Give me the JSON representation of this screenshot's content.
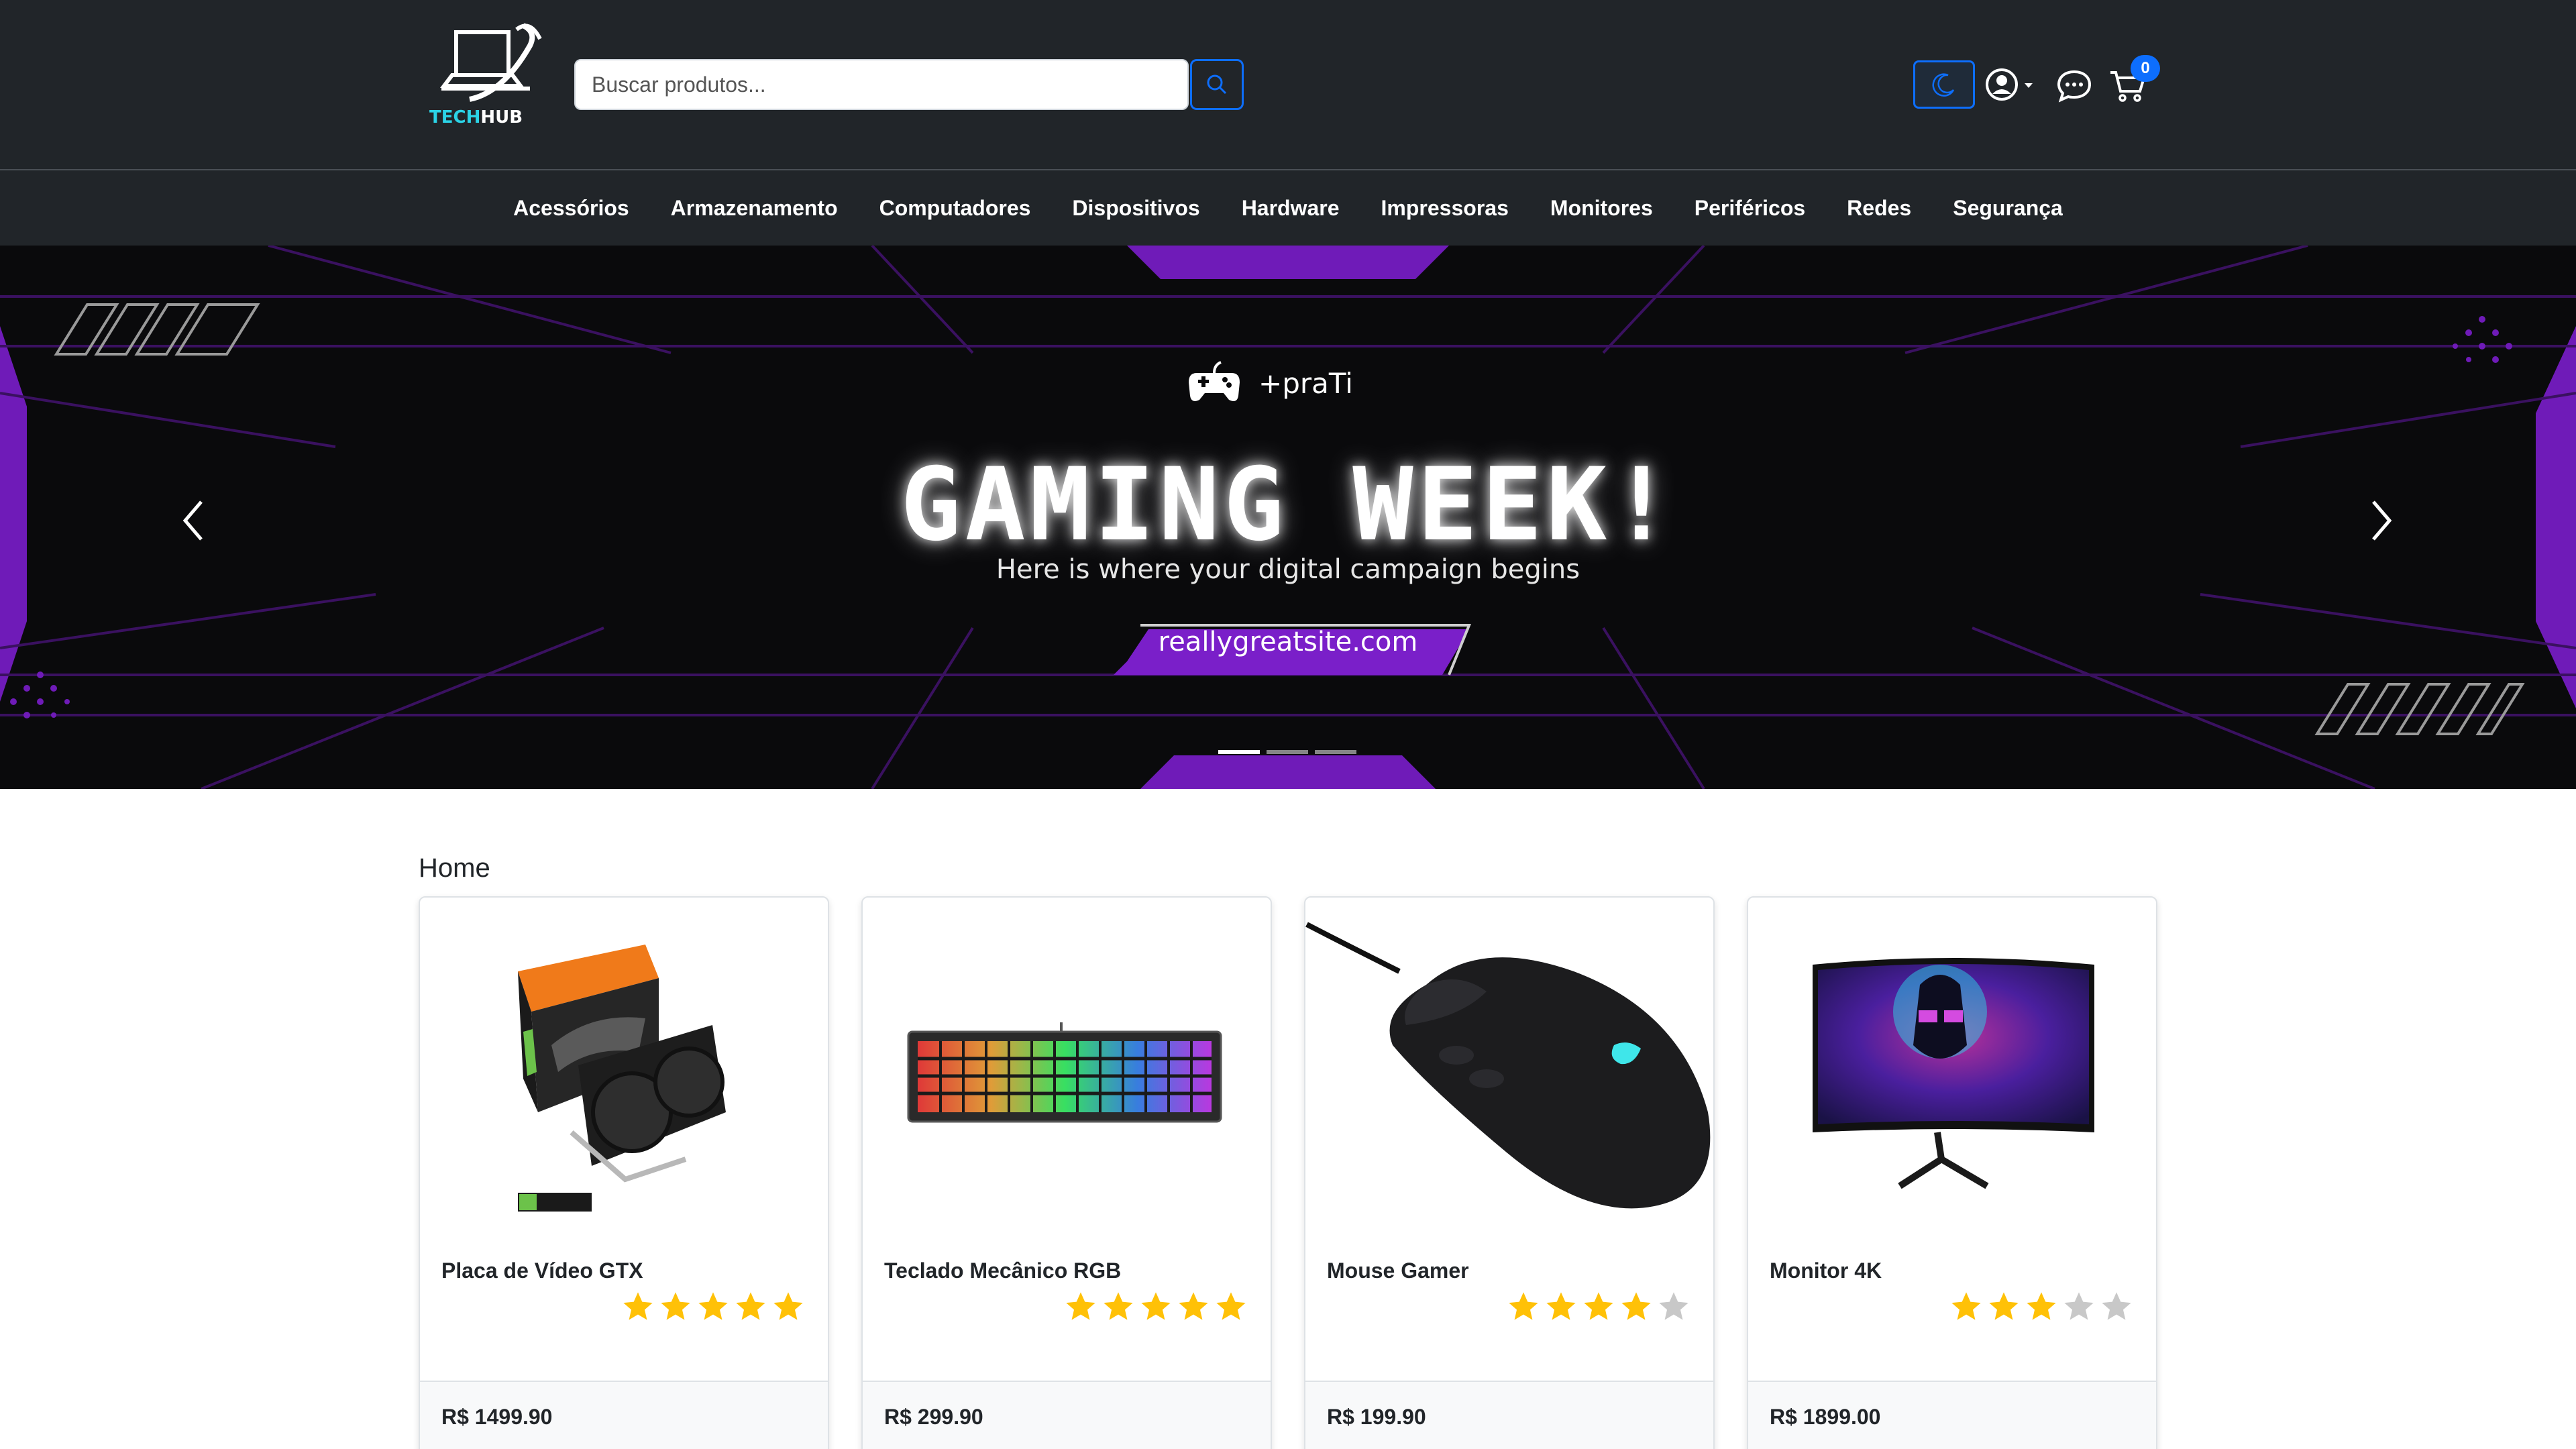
{
  "header": {
    "logo_text_a": "TECH",
    "logo_text_b": "HUB",
    "search_placeholder": "Buscar produtos...",
    "cart_count": "0"
  },
  "categories": [
    "Acessórios",
    "Armazenamento",
    "Computadores",
    "Dispositivos",
    "Hardware",
    "Impressoras",
    "Monitores",
    "Periféricos",
    "Redes",
    "Segurança"
  ],
  "hero": {
    "brand": "+praTi",
    "title": "GAMING WEEK!",
    "subtitle": "Here is where your digital campaign begins",
    "url": "reallygreatsite.com",
    "slides": 3,
    "active_slide": 1,
    "colors": {
      "accent": "#7a1fc9",
      "background": "#0a0a0c"
    }
  },
  "breadcrumb": "Home",
  "products": [
    {
      "name": "Placa de Vídeo GTX",
      "rating": 5,
      "price": "R$ 1499.90",
      "image": "graphics-card"
    },
    {
      "name": "Teclado Mecânico RGB",
      "rating": 5,
      "price": "R$ 299.90",
      "image": "rgb-keyboard"
    },
    {
      "name": "Mouse Gamer",
      "rating": 4,
      "price": "R$ 199.90",
      "image": "gaming-mouse"
    },
    {
      "name": "Monitor 4K",
      "rating": 3,
      "price": "R$ 1899.00",
      "image": "curved-monitor"
    }
  ],
  "colors": {
    "header_bg": "#212529",
    "primary": "#0d6efd",
    "star_on": "#ffc107",
    "star_off": "#c8c8c8"
  }
}
